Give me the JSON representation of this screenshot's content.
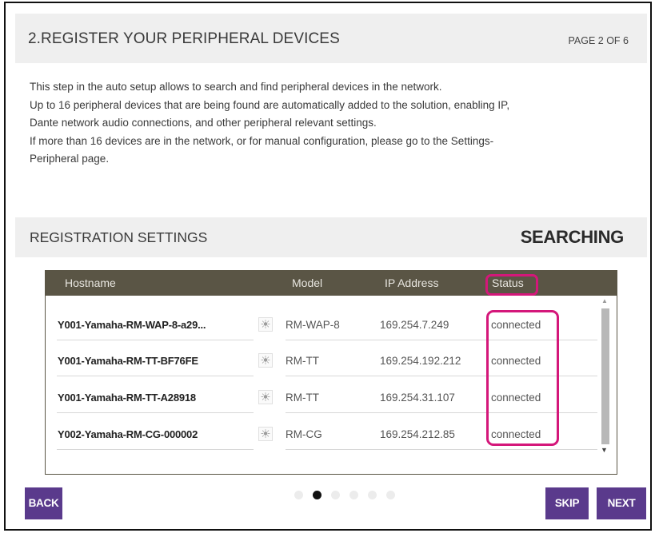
{
  "header": {
    "title": "2.REGISTER YOUR PERIPHERAL DEVICES",
    "page_indicator": "PAGE 2 OF 6"
  },
  "intro": {
    "lines": [
      "This step in the auto setup allows to search and find peripheral devices in the network.",
      "Up to 16 peripheral devices that are being found are automatically added to the solution, enabling IP,",
      "Dante network audio connections, and other peripheral relevant settings.",
      "If more than 16 devices are in the network, or for manual configuration, please go to the Settings-",
      "Peripheral page."
    ]
  },
  "settings": {
    "title": "REGISTRATION SETTINGS",
    "status": "SEARCHING"
  },
  "table": {
    "columns": [
      "Hostname",
      "Model",
      "IP Address",
      "Status"
    ],
    "rows": [
      {
        "hostname": "Y001-Yamaha-RM-WAP-8-a29...",
        "icon": "sun-icon",
        "model": "RM-WAP-8",
        "ip": "169.254.7.249",
        "status": "connected"
      },
      {
        "hostname": "Y001-Yamaha-RM-TT-BF76FE",
        "icon": "sun-icon",
        "model": "RM-TT",
        "ip": "169.254.192.212",
        "status": "connected"
      },
      {
        "hostname": "Y001-Yamaha-RM-TT-A28918",
        "icon": "sun-icon",
        "model": "RM-TT",
        "ip": "169.254.31.107",
        "status": "connected"
      },
      {
        "hostname": "Y002-Yamaha-RM-CG-000002",
        "icon": "sun-icon",
        "model": "RM-CG",
        "ip": "169.254.212.85",
        "status": "connected"
      }
    ]
  },
  "icons": {
    "sun": "☀",
    "scroll_up": "▲",
    "scroll_down": "▼"
  },
  "pager": {
    "total": 6,
    "current": 2
  },
  "buttons": {
    "back": "BACK",
    "skip": "SKIP",
    "next": "NEXT"
  },
  "colors": {
    "accent": "#5a3a8c",
    "table_header": "#5a5545",
    "highlight": "#d4177a"
  }
}
